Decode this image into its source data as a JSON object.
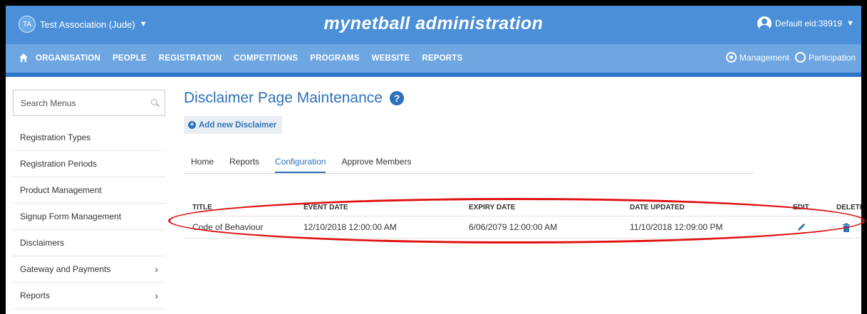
{
  "header": {
    "org_initials": "TA",
    "org_name": "Test Association (Jude)",
    "brand": "mynetball administration",
    "user_label": "Default eid:38919"
  },
  "nav": {
    "items": [
      "ORGANISATION",
      "PEOPLE",
      "REGISTRATION",
      "COMPETITIONS",
      "PROGRAMS",
      "WEBSITE",
      "REPORTS"
    ],
    "roles": [
      {
        "label": "Management",
        "selected": true
      },
      {
        "label": "Participation",
        "selected": false
      }
    ]
  },
  "sidebar": {
    "search_placeholder": "Search Menus",
    "items": [
      {
        "label": "Registration Types",
        "has_children": false
      },
      {
        "label": "Registration Periods",
        "has_children": false
      },
      {
        "label": "Product Management",
        "has_children": false
      },
      {
        "label": "Signup Form Management",
        "has_children": false
      },
      {
        "label": "Disclaimers",
        "has_children": false
      },
      {
        "label": "Gateway and Payments",
        "has_children": true
      },
      {
        "label": "Reports",
        "has_children": true
      }
    ]
  },
  "main": {
    "title": "Disclaimer Page Maintenance",
    "add_button": "Add new Disclaimer",
    "tabs": [
      {
        "label": "Home",
        "active": false
      },
      {
        "label": "Reports",
        "active": false
      },
      {
        "label": "Configuration",
        "active": true
      },
      {
        "label": "Approve Members",
        "active": false
      }
    ]
  },
  "table": {
    "columns": [
      "TITLE",
      "EVENT DATE",
      "EXPIRY DATE",
      "DATE UPDATED",
      "EDIT",
      "DELETE"
    ],
    "rows": [
      {
        "title": "Code of Behaviour",
        "event_date": "12/10/2018 12:00:00 AM",
        "expiry_date": "6/06/2079 12:00:00 AM",
        "date_updated": "11/10/2018 12:09:00 PM"
      }
    ]
  },
  "colors": {
    "topbar": "#4a8fd8",
    "navbar": "#6ea6e2",
    "accent": "#2d72b8",
    "highlight": "#e01010"
  }
}
